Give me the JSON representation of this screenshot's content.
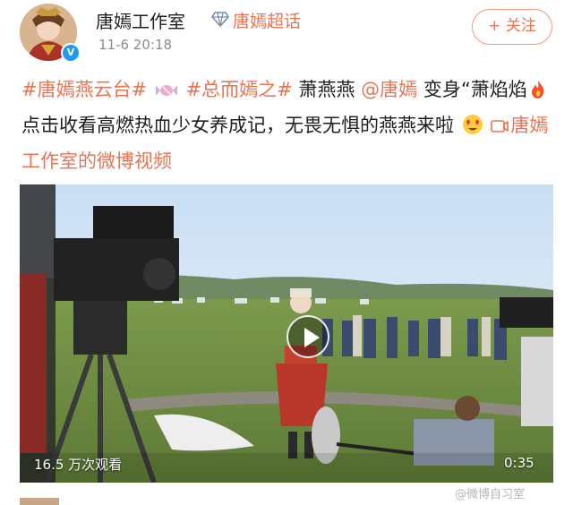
{
  "post": {
    "author": {
      "name": "唐嫣工作室",
      "verified_badge": "V",
      "avatar_icon": "avatar-icon"
    },
    "topic": {
      "icon": "diamond-icon",
      "label": "唐嫣超话"
    },
    "timestamp": "11-6 20:18",
    "follow_label": "+ 关注",
    "text": {
      "tag1": "#唐嫣燕云台#",
      "tag2": "#总而嫣之#",
      "name": "萧燕燕",
      "mention": "@唐嫣",
      "part1": "变身“萧焰焰",
      "part2": "点击收看高燃热血少女养成记，无畏无惧的燕燕来啦",
      "video_link": "唐嫣工作室的微博视频"
    },
    "video": {
      "view_count": "16.5 万次观看",
      "duration": "0:35"
    }
  },
  "watermark": "@微博自习室",
  "colors": {
    "accent": "#eb7350",
    "verified": "#1e9bf0",
    "text": "#1f1f1f",
    "meta": "#8c8c8c"
  }
}
